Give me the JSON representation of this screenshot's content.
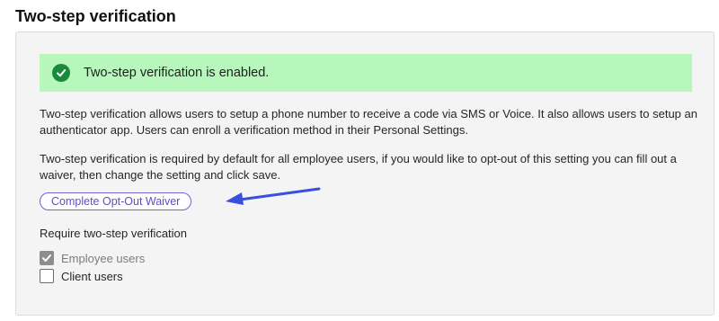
{
  "section": {
    "title": "Two-step verification"
  },
  "banner": {
    "icon": "check-circle-icon",
    "message": "Two-step verification is enabled.",
    "background_color": "#b8f7bc",
    "icon_color": "#1a8a3a"
  },
  "description": {
    "paragraph_1": "Two-step verification allows users to setup a phone number to receive a code via SMS or Voice. It also allows users to setup an authenticator app. Users can enroll a verification method in their Personal Settings.",
    "paragraph_2": "Two-step verification is required by default for all employee users, if you would like to opt-out of this setting you can fill out a waiver, then change the setting and click save."
  },
  "waiver_button": {
    "label": "Complete Opt-Out Waiver",
    "accent_color": "#5b4fc9"
  },
  "annotation": {
    "icon": "arrow-left-icon",
    "color": "#3a4ee0"
  },
  "requirement": {
    "label": "Require two-step verification",
    "options": [
      {
        "label": "Employee users",
        "checked": true,
        "disabled": true
      },
      {
        "label": "Client users",
        "checked": false,
        "disabled": false
      }
    ]
  }
}
